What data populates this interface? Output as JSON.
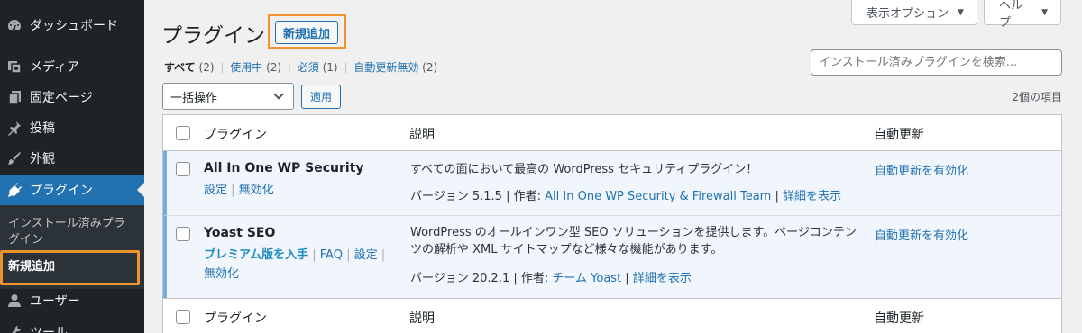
{
  "sidebar": {
    "items": [
      {
        "label": "ダッシュボード",
        "icon": "dashboard-icon"
      },
      {
        "label": "メディア",
        "icon": "media-icon"
      },
      {
        "label": "固定ページ",
        "icon": "pages-icon"
      },
      {
        "label": "投稿",
        "icon": "pin-icon"
      },
      {
        "label": "外観",
        "icon": "brush-icon"
      },
      {
        "label": "プラグイン",
        "icon": "plugin-icon"
      },
      {
        "label": "ユーザー",
        "icon": "user-icon"
      },
      {
        "label": "ツール",
        "icon": "tools-icon"
      }
    ],
    "submenu": {
      "installed": "インストール済みプラグイン",
      "add_new": "新規追加"
    }
  },
  "header": {
    "title": "プラグイン",
    "add_new_button": "新規追加",
    "screen_options": "表示オプション",
    "help": "ヘルプ"
  },
  "filters": {
    "all": {
      "label": "すべて",
      "count": "(2)"
    },
    "active": {
      "label": "使用中",
      "count": "(2)"
    },
    "required": {
      "label": "必須",
      "count": "(1)"
    },
    "auto_updates_disabled": {
      "label": "自動更新無効",
      "count": "(2)"
    }
  },
  "search": {
    "placeholder": "インストール済みプラグインを検索..."
  },
  "bulk": {
    "selected": "一括操作",
    "apply": "適用"
  },
  "items_count": "2個の項目",
  "table": {
    "columns": {
      "plugin": "プラグイン",
      "description": "説明",
      "auto_update": "自動更新"
    },
    "rows": [
      {
        "name": "All In One WP Security",
        "actions": [
          "設定",
          "無効化"
        ],
        "description": "すべての面において最高の WordPress セキュリティプラグイン！",
        "version": "バージョン 5.1.5",
        "author_label": "作者:",
        "author": "All In One WP Security & Firewall Team",
        "details": "詳細を表示",
        "auto_update": "自動更新を有効化"
      },
      {
        "name": "Yoast SEO",
        "actions": [
          "プレミアム版を入手",
          "FAQ",
          "設定",
          "無効化"
        ],
        "description": "WordPress のオールインワン型 SEO ソリューションを提供します。ページコンテンツの解析や XML サイトマップなど様々な機能があります。",
        "version": "バージョン 20.2.1",
        "author_label": "作者:",
        "author": "チーム Yoast",
        "details": "詳細を表示",
        "auto_update": "自動更新を有効化"
      }
    ]
  },
  "colors": {
    "sidebar_bg": "#1d2327",
    "active_menu": "#2271b1",
    "highlight": "#f0932b",
    "link": "#2271b1",
    "active_row_bg": "#f0f6fc"
  }
}
